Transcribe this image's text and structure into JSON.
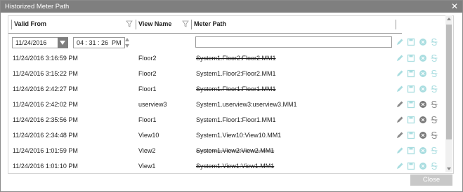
{
  "window": {
    "title": "Historized Meter Path"
  },
  "columns": {
    "valid_from": "Valid From",
    "view_name": "View Name",
    "meter_path": "Meter Path"
  },
  "editor": {
    "date": "11/24/2016",
    "time": "04 : 31 : 26  PM",
    "meter_path": ""
  },
  "rows": [
    {
      "valid_from": "11/24/2016 3:16:59 PM",
      "view_name": "Floor2",
      "meter_path": "System1.Floor2:Floor2.MM1",
      "struck": true,
      "enabled": false
    },
    {
      "valid_from": "11/24/2016 3:15:22 PM",
      "view_name": "Floor2",
      "meter_path": "System1.Floor2:Floor2.MM1",
      "struck": false,
      "enabled": false
    },
    {
      "valid_from": "11/24/2016 2:42:27 PM",
      "view_name": "Floor1",
      "meter_path": "System1.Floor1:Floor1.MM1",
      "struck": true,
      "enabled": false
    },
    {
      "valid_from": "11/24/2016 2:42:02 PM",
      "view_name": "userview3",
      "meter_path": "System1.userview3:userview3.MM1",
      "struck": false,
      "enabled": true
    },
    {
      "valid_from": "11/24/2016 2:35:56 PM",
      "view_name": "Floor1",
      "meter_path": "System1.Floor1:Floor1.MM1",
      "struck": false,
      "enabled": true
    },
    {
      "valid_from": "11/24/2016 2:34:48 PM",
      "view_name": "View10",
      "meter_path": "System1.View10:View10.MM1",
      "struck": false,
      "enabled": true
    },
    {
      "valid_from": "11/24/2016 1:01:59 PM",
      "view_name": "View2",
      "meter_path": "System1.View2:View2.MM1",
      "struck": true,
      "enabled": false
    },
    {
      "valid_from": "11/24/2016 1:01:10 PM",
      "view_name": "View1",
      "meter_path": "System1.View1:View1.MM1",
      "struck": true,
      "enabled": false
    }
  ],
  "icons": {
    "edit": "pencil-icon",
    "save": "save-icon",
    "cancel": "cancel-icon",
    "history": "strikethrough-icon",
    "filter": "filter-icon"
  },
  "colors": {
    "titlebar": "#7f7f7f",
    "icon_disabled": "#a9dde0",
    "icon_enabled": "#5a5a5a",
    "close_button": "#c8c8c8"
  },
  "footer": {
    "close_label": "Close"
  }
}
